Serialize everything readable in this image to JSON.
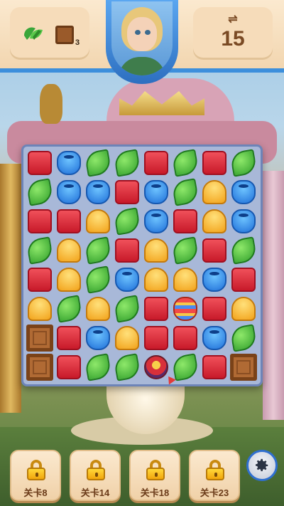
{
  "header": {
    "goals": [
      {
        "icon": "leaf-icon",
        "count": ""
      },
      {
        "icon": "crate-icon",
        "count": "3"
      }
    ],
    "moves_icon": "⇌",
    "moves_left": "15"
  },
  "board": {
    "rows": [
      [
        "red",
        "blue",
        "leaf",
        "leaf",
        "red",
        "leaf",
        "red",
        "leaf"
      ],
      [
        "leaf",
        "blue",
        "blue",
        "red",
        "blue",
        "leaf",
        "bell",
        "blue"
      ],
      [
        "red",
        "red",
        "bell",
        "leaf",
        "blue",
        "red",
        "bell",
        "blue"
      ],
      [
        "leaf",
        "bell",
        "leaf",
        "red",
        "bell",
        "leaf",
        "red",
        "leaf"
      ],
      [
        "red",
        "bell",
        "leaf",
        "blue",
        "bell",
        "bell",
        "blue",
        "red"
      ],
      [
        "bell",
        "leaf",
        "bell",
        "leaf",
        "red",
        "lantern",
        "red",
        "bell"
      ],
      [
        "crate",
        "red",
        "blue",
        "bell",
        "red",
        "red",
        "blue",
        "leaf"
      ],
      [
        "crate",
        "red",
        "leaf",
        "leaf",
        "bomb",
        "leaf",
        "red",
        "crate"
      ]
    ]
  },
  "levels": [
    {
      "label": "关卡8"
    },
    {
      "label": "关卡14"
    },
    {
      "label": "关卡18"
    },
    {
      "label": "关卡23"
    }
  ],
  "colors": {
    "accent": "#3c8fdc",
    "panel": "#f6dcba"
  }
}
